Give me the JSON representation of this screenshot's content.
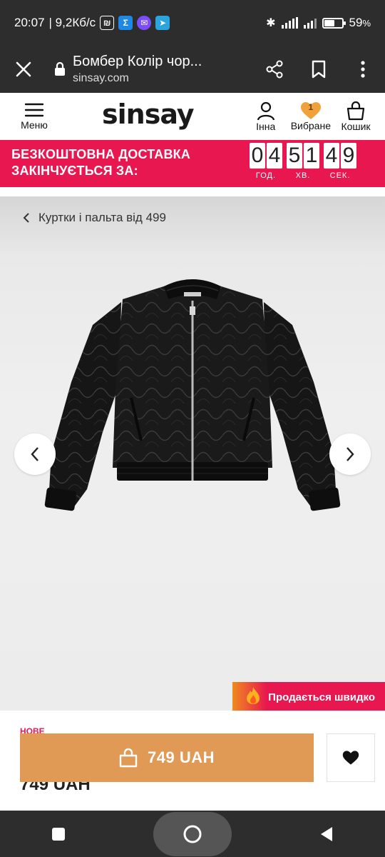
{
  "status_bar": {
    "time": "20:07",
    "speed": "| 9,2Кб/с",
    "battery": "59",
    "battery_unit": "%",
    "battery_level": 0.59
  },
  "browser": {
    "title": "Бомбер Колір чор...",
    "url": "sinsay.com"
  },
  "header": {
    "menu_label": "Меню",
    "logo": "sinsay",
    "account_label": "Інна",
    "favorites_label": "Вибране",
    "favorites_count": "1",
    "cart_label": "Кошик"
  },
  "promo": {
    "line1": "БЕЗКОШТОВНА ДОСТАВКА",
    "line2": "ЗАКІНЧУЄТЬСЯ ЗА:",
    "hours": [
      "0",
      "4"
    ],
    "minutes": [
      "5",
      "1"
    ],
    "seconds": [
      "4",
      "9"
    ],
    "hours_label": "ГОД.",
    "minutes_label": "ХВ.",
    "seconds_label": "СЕК."
  },
  "product": {
    "breadcrumb": "Куртки і пальта від 499",
    "badge": "Продається швидко",
    "new_label": "НОВЕ",
    "price": "749 UAH",
    "cart_button_price": "749 UAH"
  },
  "icons": {
    "close": "close-icon",
    "lock": "lock-icon",
    "share": "share-icon",
    "bookmark": "bookmark-icon",
    "more": "more-vertical-icon",
    "menu": "hamburger-icon",
    "user": "user-icon",
    "heart": "heart-icon",
    "bag": "bag-icon",
    "fire": "fire-icon"
  },
  "colors": {
    "brand_red": "#e8174f",
    "cart_button": "#e09a55",
    "favorite_heart": "#f0a23a"
  }
}
